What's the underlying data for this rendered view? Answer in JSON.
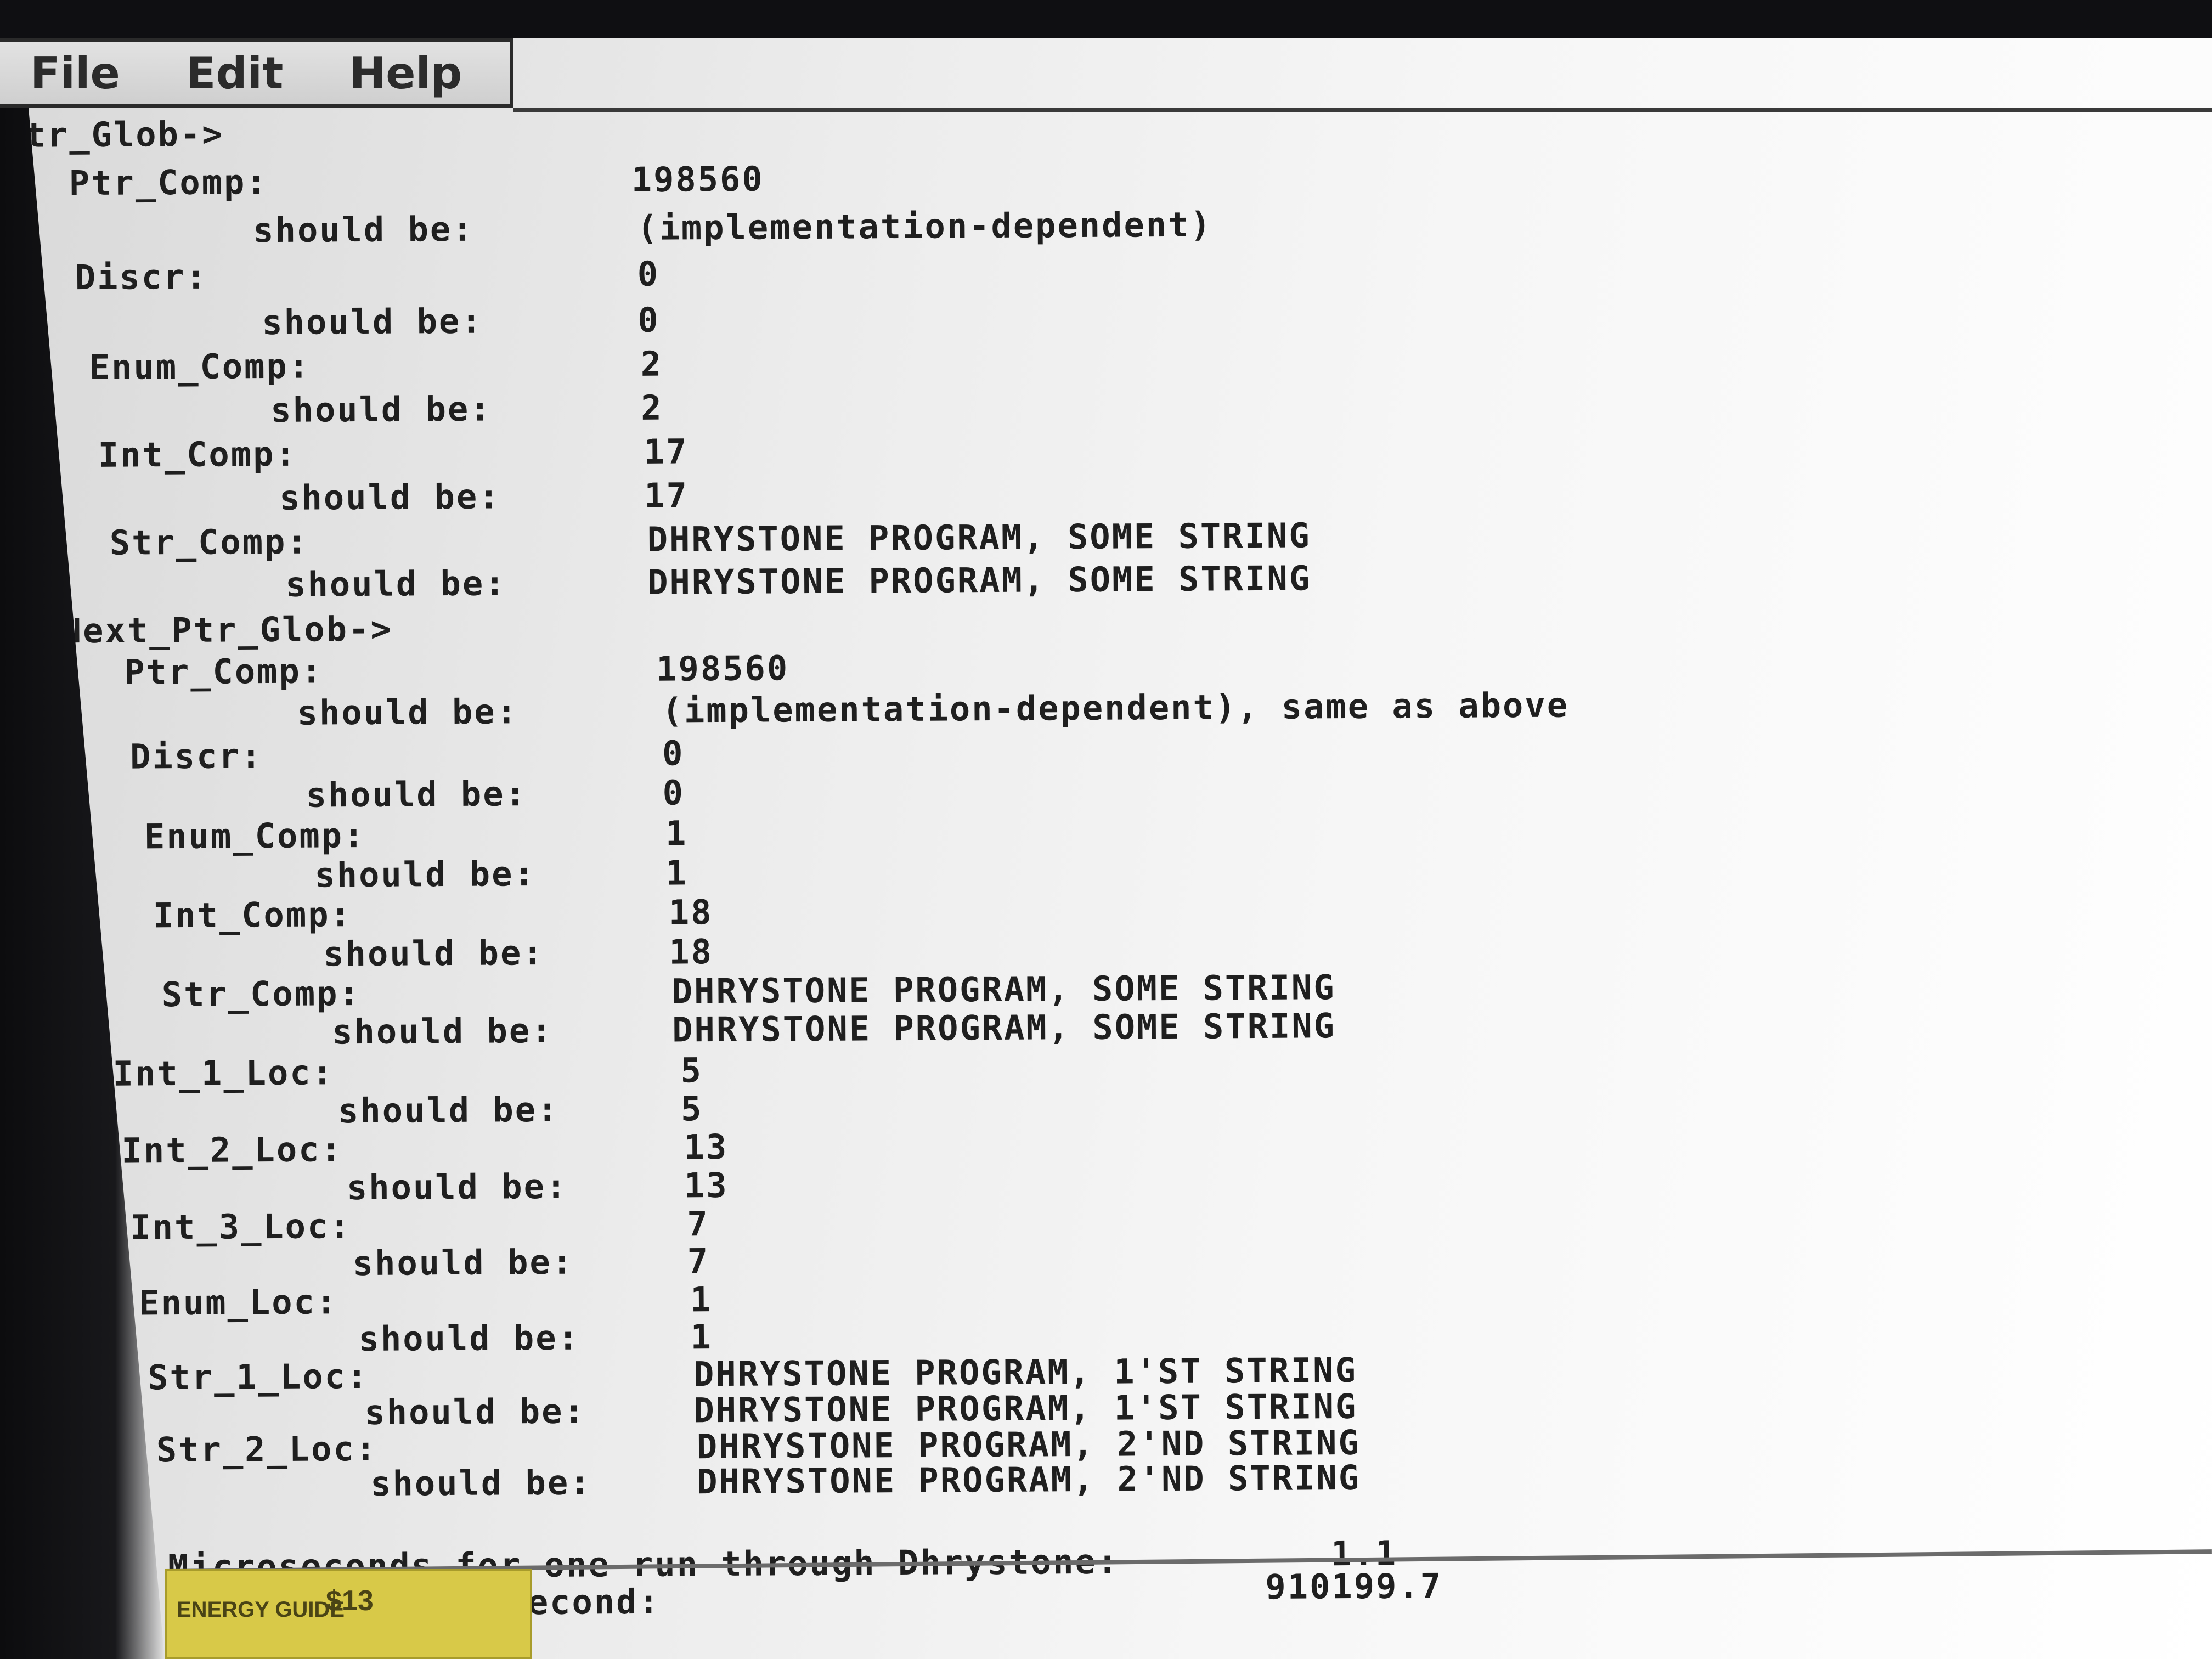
{
  "menu": {
    "file": "File",
    "edit": "Edit",
    "help": "Help"
  },
  "output_lines": [
    "Ptr_Glob->",
    "Ptr_Comp:",
    "198560",
    "should be:",
    "(implementation-dependent)",
    "Discr:",
    "0",
    "should be:",
    "0",
    "Enum_Comp:",
    "2",
    "should be:",
    "2",
    "Int_Comp:",
    "17",
    "should be:",
    "17",
    "Str_Comp:",
    "DHRYSTONE PROGRAM, SOME STRING",
    "should be:",
    "DHRYSTONE PROGRAM, SOME STRING",
    "Next_Ptr_Glob->",
    "Ptr_Comp:",
    "198560",
    "should be:",
    "(implementation-dependent), same as above",
    "Discr:",
    "0",
    "should be:",
    "0",
    "Enum_Comp:",
    "1",
    "should be:",
    "1",
    "Int_Comp:",
    "18",
    "should be:",
    "18",
    "Str_Comp:",
    "DHRYSTONE PROGRAM, SOME STRING",
    "should be:",
    "DHRYSTONE PROGRAM, SOME STRING",
    "Int_1_Loc:",
    "5",
    "should be:",
    "5",
    "Int_2_Loc:",
    "13",
    "should be:",
    "13",
    "Int_3_Loc:",
    "7",
    "should be:",
    "7",
    "Enum_Loc:",
    "1",
    "should be:",
    "1",
    "Str_1_Loc:",
    "DHRYSTONE PROGRAM, 1'ST STRING",
    "should be:",
    "DHRYSTONE PROGRAM, 1'ST STRING",
    "Str_2_Loc:",
    "DHRYSTONE PROGRAM, 2'ND STRING",
    "should be:",
    "DHRYSTONE PROGRAM, 2'ND STRING",
    "Microseconds for one run through Dhrystone:",
    "1.1",
    "Dhrystones per Second:",
    "910199.7"
  ],
  "sticker": {
    "label": "ENERGY GUIDE",
    "price": "$13"
  }
}
